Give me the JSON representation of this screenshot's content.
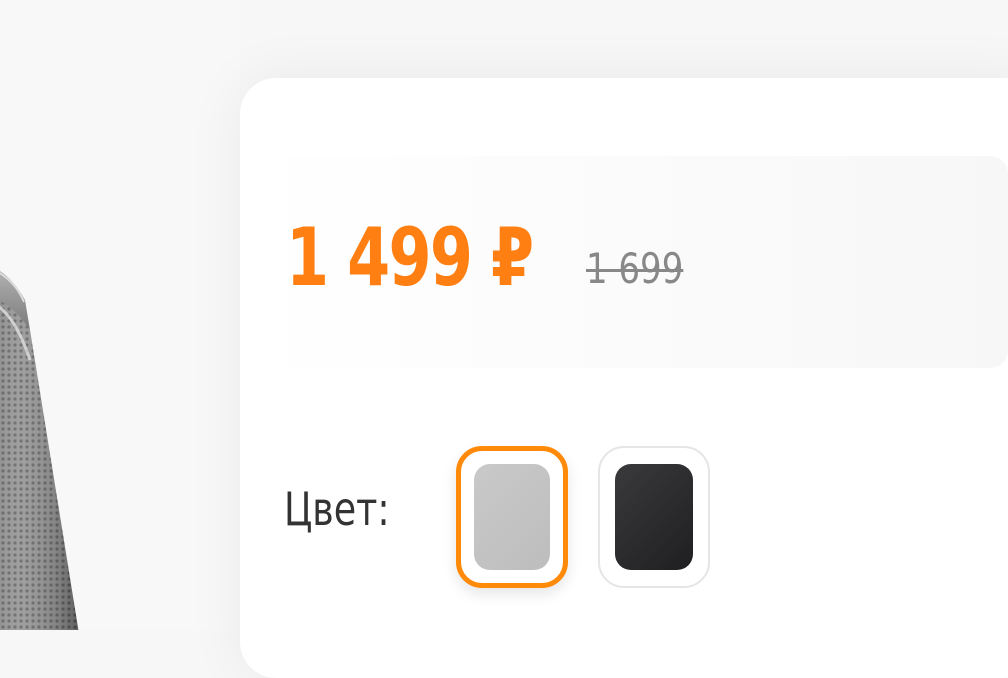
{
  "product": {
    "image_icon": "speaker-icon"
  },
  "price": {
    "current": "1 499 ₽",
    "old": "1 699",
    "accent_color": "#ff7f12"
  },
  "color_picker": {
    "label": "Цвет:",
    "options": [
      {
        "name": "silver",
        "color": "#c2c2c2",
        "selected": true
      },
      {
        "name": "black",
        "color": "#2a2a2c",
        "selected": false
      }
    ]
  }
}
